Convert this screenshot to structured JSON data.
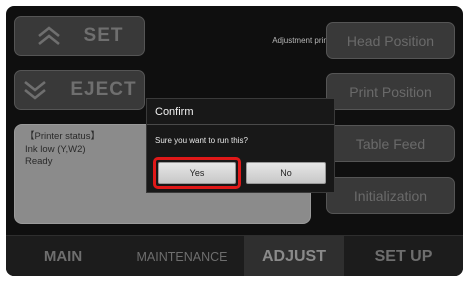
{
  "left_buttons": {
    "set_label": "SET",
    "eject_label": "EJECT"
  },
  "adjustment_print_label": "Adjustment print",
  "right_buttons": [
    {
      "label": "Head Position"
    },
    {
      "label": "Print Position"
    },
    {
      "label": "Table Feed"
    },
    {
      "label": "Initialization"
    }
  ],
  "printer_status": {
    "heading": "【Printer status】",
    "lines": [
      "Ink low (Y,W2)",
      "Ready"
    ]
  },
  "tabs": [
    {
      "label": "MAIN",
      "active": false
    },
    {
      "label": "MAINTENANCE",
      "active": false
    },
    {
      "label": "ADJUST",
      "active": true
    },
    {
      "label": "SET UP",
      "active": false
    }
  ],
  "dialog": {
    "title": "Confirm",
    "message": "Sure you want to run this?",
    "yes_label": "Yes",
    "no_label": "No"
  },
  "colors": {
    "highlight": "#e01818",
    "background": "#0f0f0f"
  },
  "icons": {
    "set": "chevron-up-icon",
    "eject": "chevron-down-icon"
  }
}
